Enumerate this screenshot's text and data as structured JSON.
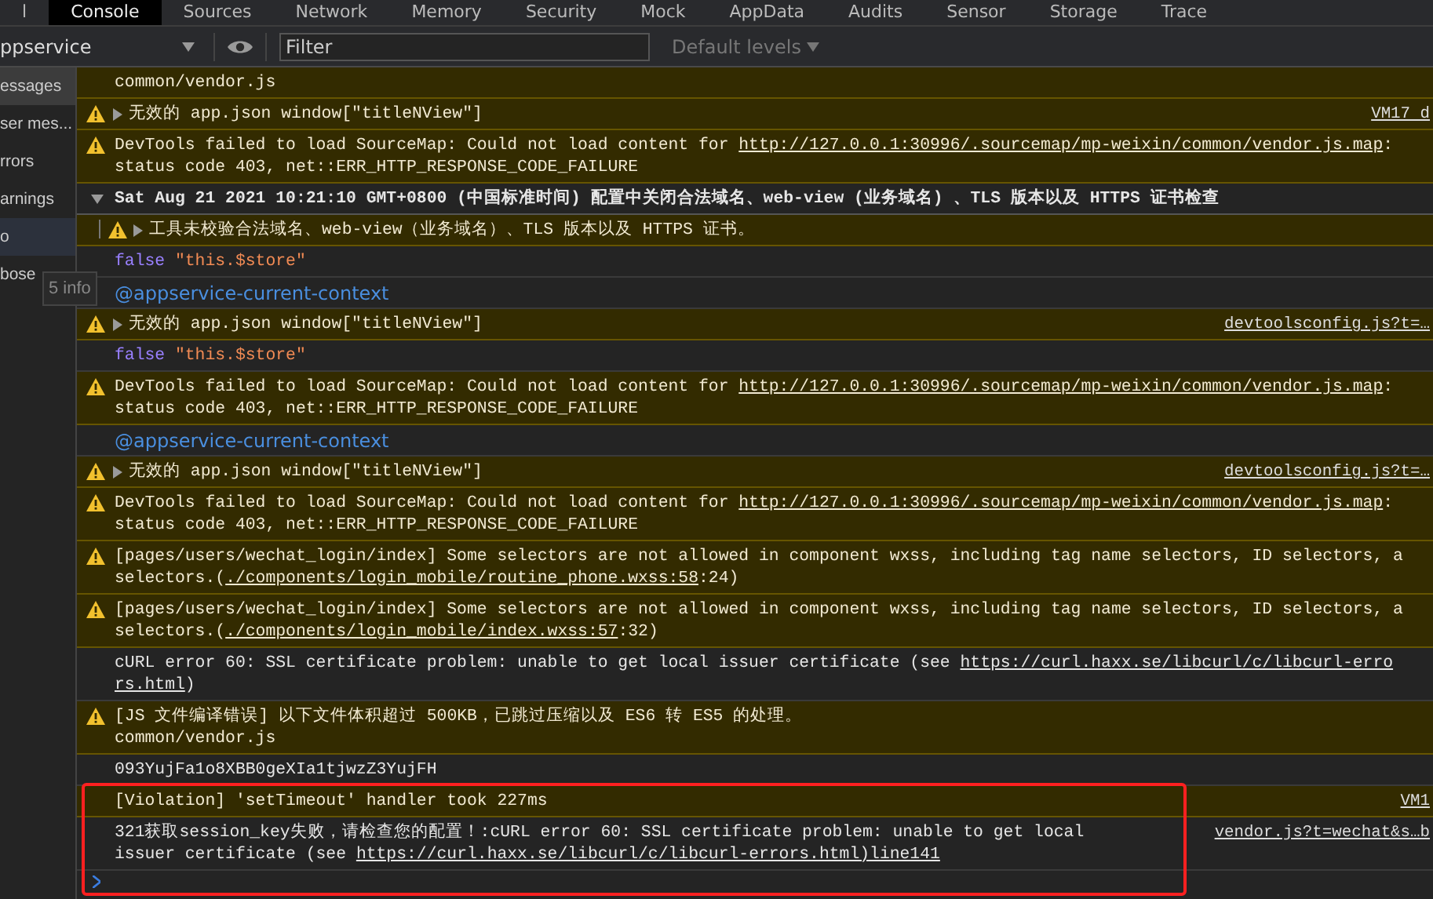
{
  "tabs": [
    {
      "label": "l",
      "selected": false
    },
    {
      "label": "Console",
      "selected": true
    },
    {
      "label": "Sources",
      "selected": false
    },
    {
      "label": "Network",
      "selected": false
    },
    {
      "label": "Memory",
      "selected": false
    },
    {
      "label": "Security",
      "selected": false
    },
    {
      "label": "Mock",
      "selected": false
    },
    {
      "label": "AppData",
      "selected": false
    },
    {
      "label": "Audits",
      "selected": false
    },
    {
      "label": "Sensor",
      "selected": false
    },
    {
      "label": "Storage",
      "selected": false
    },
    {
      "label": "Trace",
      "selected": false
    }
  ],
  "toolbar": {
    "context": "ppservice",
    "filter": {
      "placeholder": "Filter"
    },
    "levels": "Default levels"
  },
  "sidebar": {
    "items": [
      {
        "label": "essages",
        "selected": true,
        "hovered": false
      },
      {
        "label": "ser mes...",
        "selected": false,
        "hovered": false
      },
      {
        "label": "rrors",
        "selected": false,
        "hovered": false
      },
      {
        "label": "arnings",
        "selected": false,
        "hovered": false
      },
      {
        "label": "o",
        "selected": false,
        "hovered": true
      },
      {
        "label": "bose",
        "selected": false,
        "hovered": false
      }
    ],
    "tooltip": "5 info"
  },
  "messages": [
    {
      "kind": "continuation",
      "lines": [
        [
          {
            "kind": "text",
            "text": "common/vendor.js"
          }
        ]
      ]
    },
    {
      "kind": "warning",
      "expanded": false,
      "lines": [
        [
          {
            "kind": "text",
            "text": "无效的 app.json window[\"titleNView\"]"
          }
        ]
      ],
      "source": "VM17 d"
    },
    {
      "kind": "warning",
      "lines": [
        [
          {
            "kind": "text",
            "text": "DevTools failed to load SourceMap: Could not load content for "
          },
          {
            "kind": "link",
            "text": "http://127.0.0.1:30996/.sourcemap/mp-weixin/common/vendor.js.map"
          },
          {
            "kind": "text",
            "text": ":"
          }
        ],
        [
          {
            "kind": "text",
            "text": "status code 403, net::ERR_HTTP_RESPONSE_CODE_FAILURE"
          }
        ]
      ]
    },
    {
      "kind": "group",
      "expanded": true,
      "lines": [
        [
          {
            "kind": "text",
            "text": "Sat Aug 21 2021 10:21:10 GMT+0800 (中国标准时间) 配置中关闭合法域名、web-view (业务域名) 、TLS 版本以及 HTTPS 证书检查"
          }
        ]
      ]
    },
    {
      "kind": "nested-warning",
      "expanded": false,
      "lines": [
        [
          {
            "kind": "text",
            "text": "工具未校验合法域名、web-view（业务域名）、TLS 版本以及 HTTPS 证书。"
          }
        ]
      ]
    },
    {
      "kind": "log",
      "lines": [
        [
          {
            "kind": "keyword",
            "text": "false"
          },
          {
            "kind": "string",
            "text": "\"this.$store\""
          }
        ]
      ]
    },
    {
      "kind": "log",
      "lines": [
        [
          {
            "kind": "context",
            "text": "@appservice-current-context"
          }
        ]
      ]
    },
    {
      "kind": "warning",
      "expanded": false,
      "lines": [
        [
          {
            "kind": "text",
            "text": "无效的 app.json window[\"titleNView\"]"
          }
        ]
      ],
      "source": "devtoolsconfig.js?t=…"
    },
    {
      "kind": "log",
      "lines": [
        [
          {
            "kind": "keyword",
            "text": "false"
          },
          {
            "kind": "string",
            "text": "\"this.$store\""
          }
        ]
      ]
    },
    {
      "kind": "warning",
      "lines": [
        [
          {
            "kind": "text",
            "text": "DevTools failed to load SourceMap: Could not load content for "
          },
          {
            "kind": "link",
            "text": "http://127.0.0.1:30996/.sourcemap/mp-weixin/common/vendor.js.map"
          },
          {
            "kind": "text",
            "text": ":"
          }
        ],
        [
          {
            "kind": "text",
            "text": "status code 403, net::ERR_HTTP_RESPONSE_CODE_FAILURE"
          }
        ]
      ]
    },
    {
      "kind": "log",
      "lines": [
        [
          {
            "kind": "context",
            "text": "@appservice-current-context"
          }
        ]
      ]
    },
    {
      "kind": "warning",
      "expanded": false,
      "lines": [
        [
          {
            "kind": "text",
            "text": "无效的 app.json window[\"titleNView\"]"
          }
        ]
      ],
      "source": "devtoolsconfig.js?t=…"
    },
    {
      "kind": "warning",
      "lines": [
        [
          {
            "kind": "text",
            "text": "DevTools failed to load SourceMap: Could not load content for "
          },
          {
            "kind": "link",
            "text": "http://127.0.0.1:30996/.sourcemap/mp-weixin/common/vendor.js.map"
          },
          {
            "kind": "text",
            "text": ":"
          }
        ],
        [
          {
            "kind": "text",
            "text": "status code 403, net::ERR_HTTP_RESPONSE_CODE_FAILURE"
          }
        ]
      ]
    },
    {
      "kind": "warning",
      "lines": [
        [
          {
            "kind": "text",
            "text": "[pages/users/wechat_login/index] Some selectors are not allowed in component wxss, including tag name selectors, ID selectors, a"
          }
        ],
        [
          {
            "kind": "text",
            "text": "selectors.("
          },
          {
            "kind": "link",
            "text": "./components/login_mobile/routine_phone.wxss:58"
          },
          {
            "kind": "text",
            "text": ":24)"
          }
        ]
      ]
    },
    {
      "kind": "warning",
      "lines": [
        [
          {
            "kind": "text",
            "text": "[pages/users/wechat_login/index] Some selectors are not allowed in component wxss, including tag name selectors, ID selectors, a"
          }
        ],
        [
          {
            "kind": "text",
            "text": "selectors.("
          },
          {
            "kind": "link",
            "text": "./components/login_mobile/index.wxss:57"
          },
          {
            "kind": "text",
            "text": ":32)"
          }
        ]
      ]
    },
    {
      "kind": "log",
      "lines": [
        [
          {
            "kind": "text",
            "text": "cURL error 60: SSL certificate problem: unable to get local issuer certificate (see "
          },
          {
            "kind": "link",
            "text": "https://curl.haxx.se/libcurl/c/libcurl-erro"
          }
        ],
        [
          {
            "kind": "link",
            "text": "rs.html"
          },
          {
            "kind": "text",
            "text": ")"
          }
        ]
      ]
    },
    {
      "kind": "warning",
      "lines": [
        [
          {
            "kind": "text",
            "text": "[JS 文件编译错误] 以下文件体积超过 500KB，已跳过压缩以及 ES6 转 ES5 的处理。"
          }
        ],
        [
          {
            "kind": "text",
            "text": "common/vendor.js"
          }
        ]
      ]
    },
    {
      "kind": "log",
      "lines": [
        [
          {
            "kind": "text",
            "text": "093YujFa1o8XBB0geXIa1tjwzZ3YujFH"
          }
        ]
      ]
    },
    {
      "kind": "violation",
      "highlighted": true,
      "lines": [
        [
          {
            "kind": "text",
            "text": "[Violation] 'setTimeout' handler took 227ms"
          }
        ]
      ],
      "source": "VM1"
    },
    {
      "kind": "log",
      "highlighted": true,
      "lines": [
        [
          {
            "kind": "text",
            "text": "321获取session_key失败，请检查您的配置！:cURL error 60: SSL certificate problem: unable to get local"
          }
        ],
        [
          {
            "kind": "text",
            "text": "issuer certificate (see "
          },
          {
            "kind": "link",
            "text": "https://curl.haxx.se/libcurl/c/libcurl-errors.html)line141"
          }
        ]
      ],
      "source": "vendor.js?t=wechat&s…b"
    }
  ]
}
